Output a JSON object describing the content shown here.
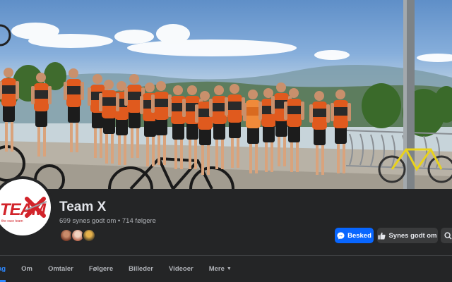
{
  "page": {
    "name": "Team X",
    "likes_text": "699 synes godt om",
    "separator": "•",
    "followers_text": "714 følgere"
  },
  "avatar": {
    "logo_text": "TEAMX",
    "logo_main": "TEAM",
    "logo_sub": "the race team"
  },
  "actions": {
    "message_label": "Besked",
    "like_label": "Synes godt om"
  },
  "tabs": [
    {
      "label": "Opslag",
      "visible_text": "ag",
      "active": true
    },
    {
      "label": "Om"
    },
    {
      "label": "Omtaler"
    },
    {
      "label": "Følgere"
    },
    {
      "label": "Billeder"
    },
    {
      "label": "Videoer"
    },
    {
      "label": "Mere",
      "caret": "▼"
    }
  ],
  "colors": {
    "background": "#242526",
    "accent_blue": "#0866ff",
    "tab_active": "#2d88ff",
    "text_primary": "#e4e6eb",
    "text_secondary": "#b0b3b8",
    "jersey_orange": "#e05a1e",
    "logo_red": "#d2232a"
  },
  "icons": {
    "message": "messenger-icon",
    "like": "thumbs-up-icon",
    "search": "search-icon"
  }
}
